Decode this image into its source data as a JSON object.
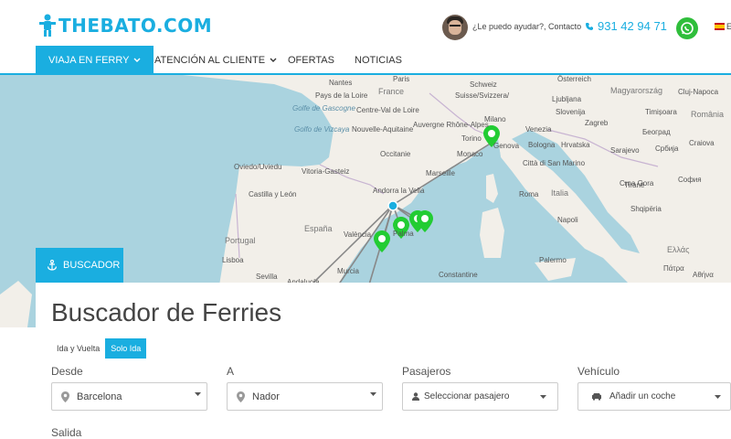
{
  "header": {
    "logo_text": "THEBATO.COM",
    "help_text": "¿Le puedo ayudar?, Contacto",
    "phone": "931 42 94 71",
    "lang": "E",
    "brand_color": "#1aaee0"
  },
  "nav": {
    "items": [
      {
        "label": "VIAJA EN FERRY"
      },
      {
        "label": "ATENCIÓN AL CLIENTE"
      },
      {
        "label": "OFERTAS"
      },
      {
        "label": "NOTICIAS"
      }
    ]
  },
  "map": {
    "labels": {
      "nantes": "Nantes",
      "paris": "Paris",
      "france": "France",
      "golfe": "Golfe de Gascogne",
      "golfo": "Golfo de Vizcaya",
      "oviedo": "Oviedo/Uviedu",
      "vitoria": "Vitoria-Gasteiz",
      "castilla": "Castilla y León",
      "espana": "España",
      "portugal": "Portugal",
      "lisboa": "Lisboa",
      "valencia": "València",
      "sevilla": "Sevilla",
      "andalucia": "Andalucía",
      "murcia": "Murcia",
      "andorra": "Andorra la Vella",
      "marseille": "Marseille",
      "torino": "Torino",
      "milano": "Milano",
      "genova": "Genova",
      "monaco": "Monaco",
      "suisse": "Suisse/Svizzera/",
      "schweiz": "Schweiz",
      "aquitaine": "Nouvelle-Aquitaine",
      "occitanie": "Occitanie",
      "auvergne": "Auvergne Rhône-Alpes",
      "pays": "Pays de la Loire",
      "centre": "Centre-Val de Loire",
      "venezia": "Venezia",
      "bologna": "Bologna",
      "citta": "Città di San Marino",
      "italia": "Italia",
      "roma": "Roma",
      "napoli": "Napoli",
      "palermo": "Palermo",
      "constantine": "Constantine",
      "oesterreich": "Österreich",
      "magyarorszag": "Magyarország",
      "slovenija": "Slovenija",
      "hrvatska": "Hrvatska",
      "srbija": "Србија",
      "sarajevo": "Sarajevo",
      "beograd": "Београд",
      "romania": "România",
      "craiova": "Craiova",
      "sofia": "София",
      "shqiperia": "Shqipëria",
      "ellada": "Ελλάς",
      "patra": "Πάτρα",
      "athina": "Αθήνα",
      "tirana": "Tiranë",
      "cluj": "Cluj-Napoca",
      "timisoara": "Timișoara",
      "podgorica": "Crna Gora",
      "ljubljana": "Ljubljana",
      "zagreb": "Zagreb",
      "palma": "Palma"
    }
  },
  "buscador": {
    "tab_label": "BUSCADOR",
    "title": "Buscador de Ferries",
    "trip_tabs": [
      {
        "label": "Ida y Vuelta"
      },
      {
        "label": "Solo Ida"
      }
    ],
    "desde_label": "Desde",
    "desde_value": "Barcelona",
    "a_label": "A",
    "a_value": "Nador",
    "pasajeros_label": "Pasajeros",
    "pasajeros_value": "Seleccionar pasajero",
    "vehiculo_label": "Vehículo",
    "vehiculo_value": "Añadir un coche",
    "salida_label": "Salida"
  }
}
